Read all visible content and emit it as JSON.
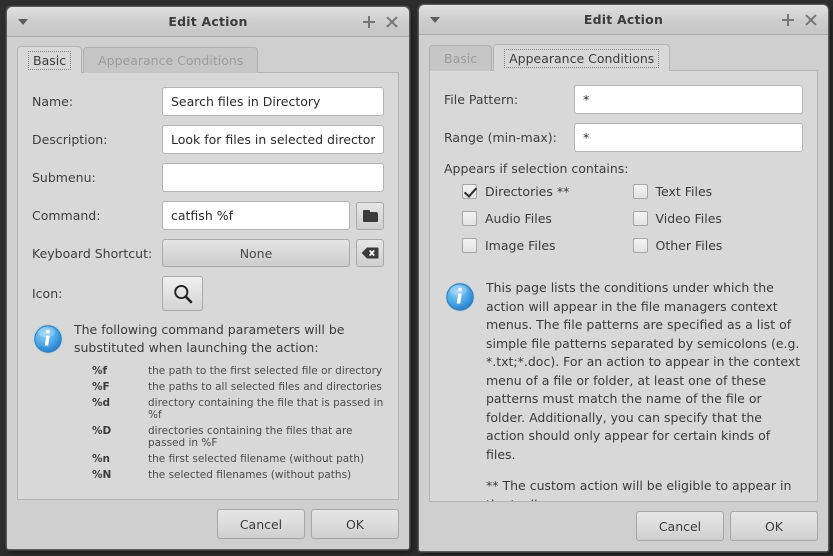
{
  "windows": {
    "left": {
      "title": "Edit Action",
      "titlebar": {
        "menu_icon": "menu-arrow-icon",
        "add_icon": "plus-icon",
        "close_icon": "close-icon"
      },
      "tabs": [
        {
          "label": "Basic",
          "active": true
        },
        {
          "label": "Appearance Conditions",
          "active": false
        }
      ],
      "fields": [
        {
          "label": "Name:",
          "value": "Search files in Directory",
          "placeholder": ""
        },
        {
          "label": "Description:",
          "value": "Look for files in selected directory",
          "placeholder": ""
        },
        {
          "label": "Submenu:",
          "value": "",
          "placeholder": ""
        },
        {
          "label": "Command:",
          "value": "catfish %f",
          "placeholder": ""
        }
      ],
      "command_browse_icon": "folder-icon",
      "shortcut": {
        "label": "Keyboard Shortcut:",
        "value": "None",
        "clear_icon": "backspace-clear-icon"
      },
      "icon_field": {
        "label": "Icon:",
        "icon": "magnifier-icon"
      },
      "info": {
        "icon": "info-icon",
        "text": "The following command parameters will be substituted when launching the action:",
        "params": [
          {
            "key": "%f",
            "desc": "the path to the first selected file or directory"
          },
          {
            "key": "%F",
            "desc": "the paths to all selected files and directories"
          },
          {
            "key": "%d",
            "desc": "directory containing the file that is passed in %f"
          },
          {
            "key": "%D",
            "desc": "directories containing the files that are passed in %F"
          },
          {
            "key": "%n",
            "desc": "the first selected filename (without path)"
          },
          {
            "key": "%N",
            "desc": "the selected filenames (without paths)"
          }
        ]
      },
      "buttons": {
        "cancel": "Cancel",
        "ok": "OK"
      }
    },
    "right": {
      "title": "Edit Action",
      "titlebar": {
        "menu_icon": "menu-arrow-icon",
        "add_icon": "plus-icon",
        "close_icon": "close-icon"
      },
      "tabs": [
        {
          "label": "Basic",
          "active": false
        },
        {
          "label": "Appearance Conditions",
          "active": true
        }
      ],
      "fields": [
        {
          "label": "File Pattern:",
          "value": "*",
          "placeholder": ""
        },
        {
          "label": "Range (min-max):",
          "value": "*",
          "placeholder": ""
        }
      ],
      "section_label": "Appears if selection contains:",
      "checkboxes": [
        {
          "label": "Directories **",
          "checked": true
        },
        {
          "label": "Text Files",
          "checked": false
        },
        {
          "label": "Audio Files",
          "checked": false
        },
        {
          "label": "Video Files",
          "checked": false
        },
        {
          "label": "Image Files",
          "checked": false
        },
        {
          "label": "Other Files",
          "checked": false
        }
      ],
      "info": {
        "icon": "info-icon",
        "paragraph1": "This page lists the conditions under which the action will appear in the file managers context menus. The file patterns are specified as a list of simple file patterns separated by semicolons (e.g. *.txt;*.doc). For an action to appear in the context menu of a file or folder, at least one of these patterns must match the name of the file or folder. Additionally, you can specify that the action should only appear for certain kinds of files.",
        "paragraph2": "** The custom action will be eligible to appear in the toolbar."
      },
      "buttons": {
        "cancel": "Cancel",
        "ok": "OK"
      }
    }
  },
  "colors": {
    "window_chrome": "#cfcfcf",
    "tab_page": "#d8d8d8",
    "field_background": "#ffffff",
    "text_primary": "#3a3a3a",
    "text_muted": "#9b9b9b",
    "info_icon_blue": "#3d9ae2",
    "desktop_background": "#2e2e2e"
  }
}
